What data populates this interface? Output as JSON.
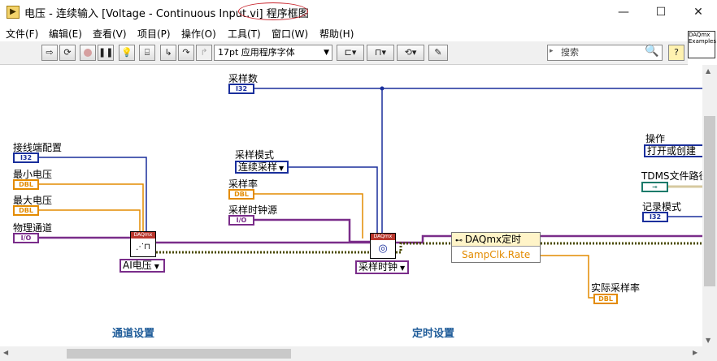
{
  "window": {
    "icon_glyph": "▶",
    "title": "电压 - 连续输入 [Voltage - Continuous Input.vi] 程序框图",
    "minimize_glyph": "—",
    "maximize_glyph": "☐",
    "close_glyph": "✕"
  },
  "menu": [
    "文件(F)",
    "编辑(E)",
    "查看(V)",
    "项目(P)",
    "操作(O)",
    "工具(T)",
    "窗口(W)",
    "帮助(H)"
  ],
  "toolbar": {
    "font_select": "17pt 应用程序字体",
    "search_placeholder": "搜索",
    "help_glyph": "?",
    "example_icon_text": "DAQmx Examples"
  },
  "diagram": {
    "labels": {
      "sample_count": "采样数",
      "terminal_config": "接线端配置",
      "min_voltage": "最小电压",
      "max_voltage": "最大电压",
      "physical_channel": "物理通道",
      "sample_mode": "采样模式",
      "sample_rate": "采样率",
      "sample_clock_source": "采样时钟源",
      "operation": "操作",
      "tdms_path": "TDMS文件路径",
      "logging_mode": "记录模式",
      "actual_rate": "实际采样率"
    },
    "terminals": {
      "i32": "I32",
      "dbl": "DBL",
      "io": "I/O"
    },
    "rings": {
      "sample_mode_value": "连续采样",
      "operation_value": "打开或创建"
    },
    "subvis": {
      "create_channel_header": "DAQmx",
      "timing_header": "DAQmx",
      "create_channel_selector": "AI电压",
      "timing_selector": "采样时钟"
    },
    "property_node": {
      "title": "DAQmx定时",
      "property": "SampClk.Rate"
    },
    "sections": {
      "channel_setup": "通道设置",
      "timing_setup": "定时设置"
    }
  },
  "colors": {
    "int_wire": "#1a2f9c",
    "dbl_wire": "#e38b00",
    "io_wire": "#7a2d8a",
    "task_wire": "#3c3c00",
    "title_highlight": "#c8242c"
  }
}
